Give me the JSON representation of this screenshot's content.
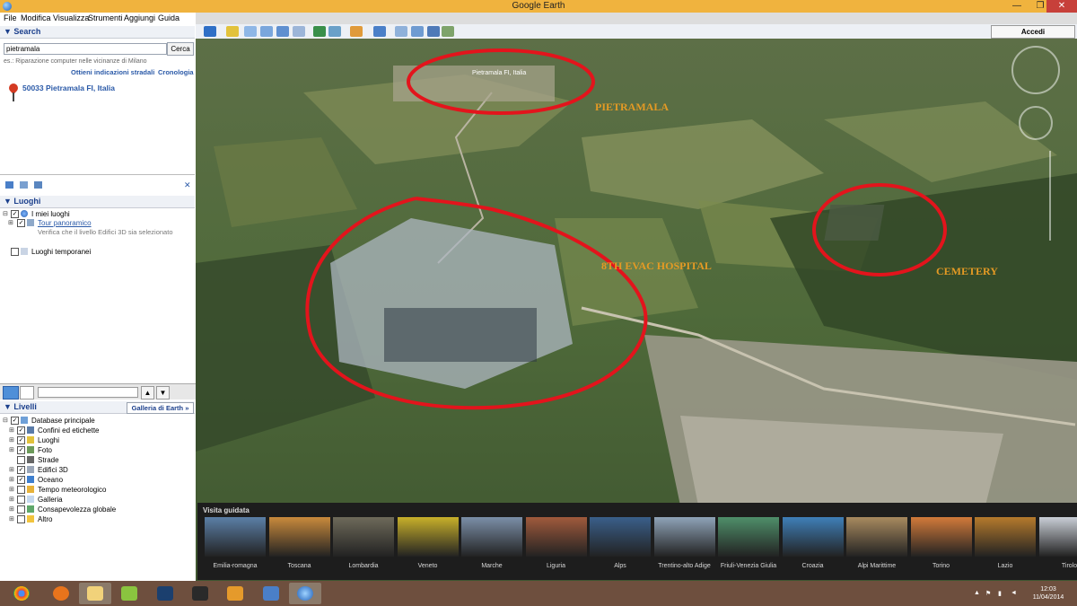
{
  "window": {
    "title": "Google Earth",
    "min_symbol": "—",
    "max_symbol": "❐",
    "close_symbol": "✕"
  },
  "menu": [
    "File",
    "Modifica",
    "Visualizza",
    "Strumenti",
    "Aggiungi",
    "Guida"
  ],
  "search": {
    "header": "▼ Search",
    "query": "pietramala",
    "button": "Cerca",
    "hint": "es.: Riparazione computer nelle vicinanze di Milano",
    "link_directions": "Ottieni indicazioni stradali",
    "link_history": "Cronologia",
    "result": "50033 Pietramala FI, Italia",
    "close_symbol": "✕"
  },
  "places": {
    "header": "▼ Luoghi",
    "my_places": "I miei luoghi",
    "tour_link": "Tour panoramico",
    "tour_note": "Verifica che il livello Edifici 3D sia selezionato",
    "temp_places": "Luoghi temporanei"
  },
  "layers": {
    "header": "▼ Livelli",
    "gallery_button": "Galleria di Earth »",
    "items": [
      {
        "label": "Database principale",
        "checked": true
      },
      {
        "label": "Confini ed etichette",
        "checked": true
      },
      {
        "label": "Luoghi",
        "checked": true
      },
      {
        "label": "Foto",
        "checked": true
      },
      {
        "label": "Strade",
        "checked": false
      },
      {
        "label": "Edifici 3D",
        "checked": true
      },
      {
        "label": "Oceano",
        "checked": true
      },
      {
        "label": "Tempo meteorologico",
        "checked": false
      },
      {
        "label": "Galleria",
        "checked": false
      },
      {
        "label": "Consapevolezza globale",
        "checked": false
      },
      {
        "label": "Altro",
        "checked": false
      }
    ]
  },
  "toolbar": {
    "signin": "Accedi"
  },
  "map": {
    "label_pietramala": "Pietramala",
    "label_hospital": "8th Evac Hospital",
    "label_cemetery": "Cemetery",
    "place_label": "Pietramala FI, Italia",
    "label_color": "#e49a24",
    "annotation_color": "#e3141c"
  },
  "tour": {
    "title": "Visita guidata",
    "items": [
      "Emilia-romagna",
      "Toscana",
      "Lombardia",
      "Veneto",
      "Marche",
      "Liguria",
      "Alps",
      "Trentino-alto Adige",
      "Friuli-Venezia Giulia",
      "Croazia",
      "Alpi Marittime",
      "Torino",
      "Lazio",
      "Tirolo"
    ]
  },
  "taskbar": {
    "time": "12:03",
    "date": "11/04/2014"
  }
}
